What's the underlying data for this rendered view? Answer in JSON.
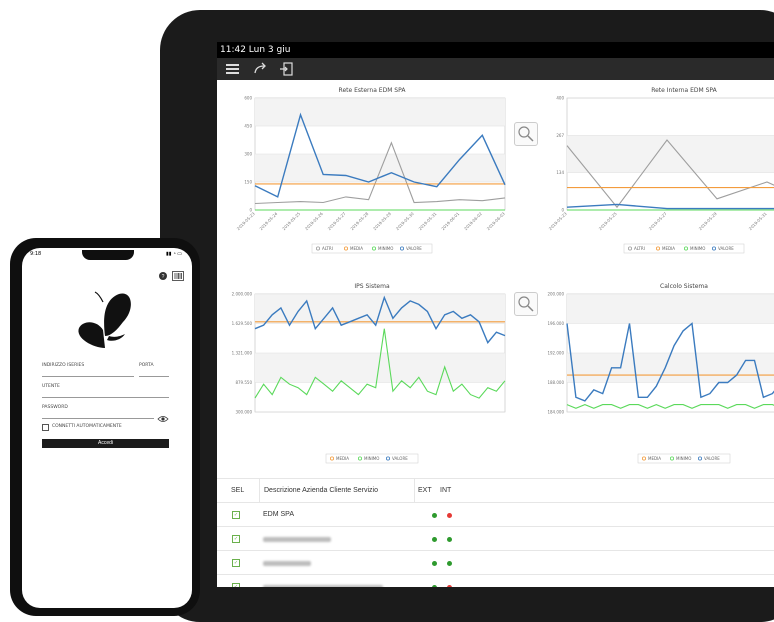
{
  "tablet": {
    "status_bar": {
      "time_date": "11:42  Lun 3 giu"
    },
    "toolbar": {
      "menu_icon": "hamburger-icon",
      "redo_icon": "share-arrow-icon",
      "exit_icon": "exit-door-icon"
    },
    "charts": {
      "rete_esterna": {
        "title": "Rete Esterna EDM SPA"
      },
      "rete_interna": {
        "title": "Rete Interna EDM SPA"
      },
      "ips": {
        "title": "IPS Sistema"
      },
      "calcolo": {
        "title": "Calcolo Sistema"
      }
    },
    "table": {
      "headers": [
        "SEL",
        "Descrizione Azienda Cliente Servizio",
        "EXT",
        "INT"
      ],
      "rows": [
        {
          "name": "EDM SPA",
          "ext": "green",
          "int": "red"
        },
        {
          "name": "",
          "ext": "green",
          "int": "green"
        },
        {
          "name": "",
          "ext": "green",
          "int": "green"
        },
        {
          "name": "",
          "ext": "green",
          "int": "red"
        }
      ]
    }
  },
  "phone": {
    "status_time": "9:18",
    "labels": {
      "server_address": "INDIRIZZO ISERIES",
      "port": "PORTA",
      "user": "UTENTE",
      "password": "PASSWORD",
      "auto_connect": "CONNETTI AUTOMATICAMENTE",
      "login_button": "Accedi"
    },
    "icons": {
      "help": "help-globe-icon",
      "barcode": "barcode-icon",
      "eye": "eye-icon",
      "logo": "butterfly-logo-icon"
    }
  },
  "colors": {
    "altri": "#9e9e9e",
    "media": "#f39c3d",
    "minimo": "#5bd95b",
    "valore": "#3b7bbf"
  },
  "chart_data": [
    {
      "type": "line",
      "title": "Rete Esterna EDM SPA",
      "ylim": [
        0,
        600
      ],
      "yticks": [
        "0",
        "150",
        "300",
        "450",
        "600"
      ],
      "categories": [
        "2019-05-23",
        "2019-05-24",
        "2019-05-25",
        "2019-05-26",
        "2019-05-27",
        "2019-05-28",
        "2019-05-29",
        "2019-05-30",
        "2019-05-31",
        "2019-06-01",
        "2019-06-02",
        "2019-06-03"
      ],
      "legend": [
        "ALTRI",
        "MEDIA",
        "MINIMO",
        "VALORE"
      ],
      "series": [
        {
          "name": "ALTRI",
          "values": [
            35,
            40,
            45,
            40,
            70,
            55,
            360,
            40,
            45,
            55,
            50,
            65
          ]
        },
        {
          "name": "MEDIA",
          "values": [
            140,
            140,
            140,
            140,
            140,
            140,
            140,
            140,
            140,
            140,
            140,
            140
          ]
        },
        {
          "name": "MINIMO",
          "values": [
            0,
            0,
            0,
            0,
            0,
            0,
            0,
            0,
            0,
            0,
            0,
            0
          ]
        },
        {
          "name": "VALORE",
          "values": [
            130,
            70,
            510,
            190,
            185,
            150,
            200,
            150,
            125,
            270,
            400,
            135
          ]
        }
      ]
    },
    {
      "type": "line",
      "title": "Rete Interna EDM SPA",
      "ylim": [
        0,
        400
      ],
      "yticks": [
        "0",
        "134",
        "267",
        "400"
      ],
      "categories": [
        "2019-05-23",
        "2019-05-25",
        "2019-05-27",
        "2019-05-29",
        "2019-05-31",
        "2019-06-02"
      ],
      "legend": [
        "ALTRI",
        "MEDIA",
        "MINIMO",
        "VALORE"
      ],
      "series": [
        {
          "name": "ALTRI",
          "values": [
            230,
            10,
            250,
            40,
            100,
            20
          ]
        },
        {
          "name": "MEDIA",
          "values": [
            80,
            80,
            80,
            80,
            80,
            80
          ]
        },
        {
          "name": "MINIMO",
          "values": [
            0,
            0,
            0,
            0,
            0,
            0
          ]
        },
        {
          "name": "VALORE",
          "values": [
            10,
            20,
            5,
            5,
            5,
            5
          ]
        }
      ]
    },
    {
      "type": "line",
      "title": "IPS Sistema",
      "ylim": [
        300000,
        2000000
      ],
      "yticks": [
        "300.000",
        "879.550",
        "1.321.000",
        "1.629.500",
        "2.000.000"
      ],
      "legend": [
        "MEDIA",
        "MINIMO",
        "VALORE"
      ],
      "series": [
        {
          "name": "MEDIA",
          "values": [
            1600000,
            1600000,
            1600000,
            1600000,
            1600000,
            1600000,
            1600000,
            1600000,
            1600000,
            1600000,
            1600000,
            1600000,
            1600000,
            1600000,
            1600000,
            1600000,
            1600000,
            1600000,
            1600000,
            1600000,
            1600000,
            1600000,
            1600000,
            1600000,
            1600000,
            1600000,
            1600000,
            1600000,
            1600000,
            1600000
          ]
        },
        {
          "name": "MINIMO",
          "values": [
            500000,
            700000,
            550000,
            800000,
            700000,
            650000,
            550000,
            800000,
            700000,
            600000,
            750000,
            650000,
            550000,
            700000,
            650000,
            1500000,
            600000,
            750000,
            650000,
            800000,
            600000,
            550000,
            950000,
            600000,
            700000,
            550000,
            500000,
            650000,
            600000,
            750000
          ]
        },
        {
          "name": "VALORE",
          "values": [
            1500000,
            1550000,
            1700000,
            1800000,
            1550000,
            1750000,
            1900000,
            1500000,
            1650000,
            1800000,
            1550000,
            1600000,
            1650000,
            1700000,
            1550000,
            1950000,
            1650000,
            1800000,
            1900000,
            1850000,
            1750000,
            1500000,
            1700000,
            1750000,
            1650000,
            1700000,
            1600000,
            1300000,
            1450000,
            1400000
          ]
        }
      ]
    },
    {
      "type": "line",
      "title": "Calcolo Sistema",
      "ylim": [
        184000,
        200000
      ],
      "yticks": [
        "184.000",
        "188.000",
        "192.000",
        "196.000",
        "200.000"
      ],
      "legend": [
        "MEDIA",
        "MINIMO",
        "VALORE"
      ],
      "series": [
        {
          "name": "MEDIA",
          "values": [
            189000,
            189000,
            189000,
            189000,
            189000,
            189000,
            189000,
            189000,
            189000,
            189000,
            189000,
            189000,
            189000,
            189000,
            189000,
            189000,
            189000,
            189000,
            189000,
            189000,
            189000,
            189000,
            189000,
            189000,
            189000,
            189000,
            189000,
            189000,
            189000
          ]
        },
        {
          "name": "MINIMO",
          "values": [
            185000,
            184500,
            185000,
            184500,
            185000,
            185000,
            184500,
            185000,
            185000,
            184500,
            185000,
            184500,
            185000,
            185000,
            184500,
            185000,
            185000,
            185000,
            184500,
            185000,
            185000,
            184500,
            185000,
            185000,
            184500,
            185000,
            185000,
            184500,
            185000
          ]
        },
        {
          "name": "VALORE",
          "values": [
            196000,
            186000,
            185500,
            187000,
            186500,
            190000,
            190000,
            196000,
            186000,
            186000,
            187500,
            190000,
            193000,
            195000,
            196000,
            186000,
            186500,
            188000,
            188000,
            189000,
            191000,
            191000,
            186000,
            186500,
            188000,
            189000,
            189000,
            190000,
            190500
          ]
        }
      ]
    }
  ]
}
